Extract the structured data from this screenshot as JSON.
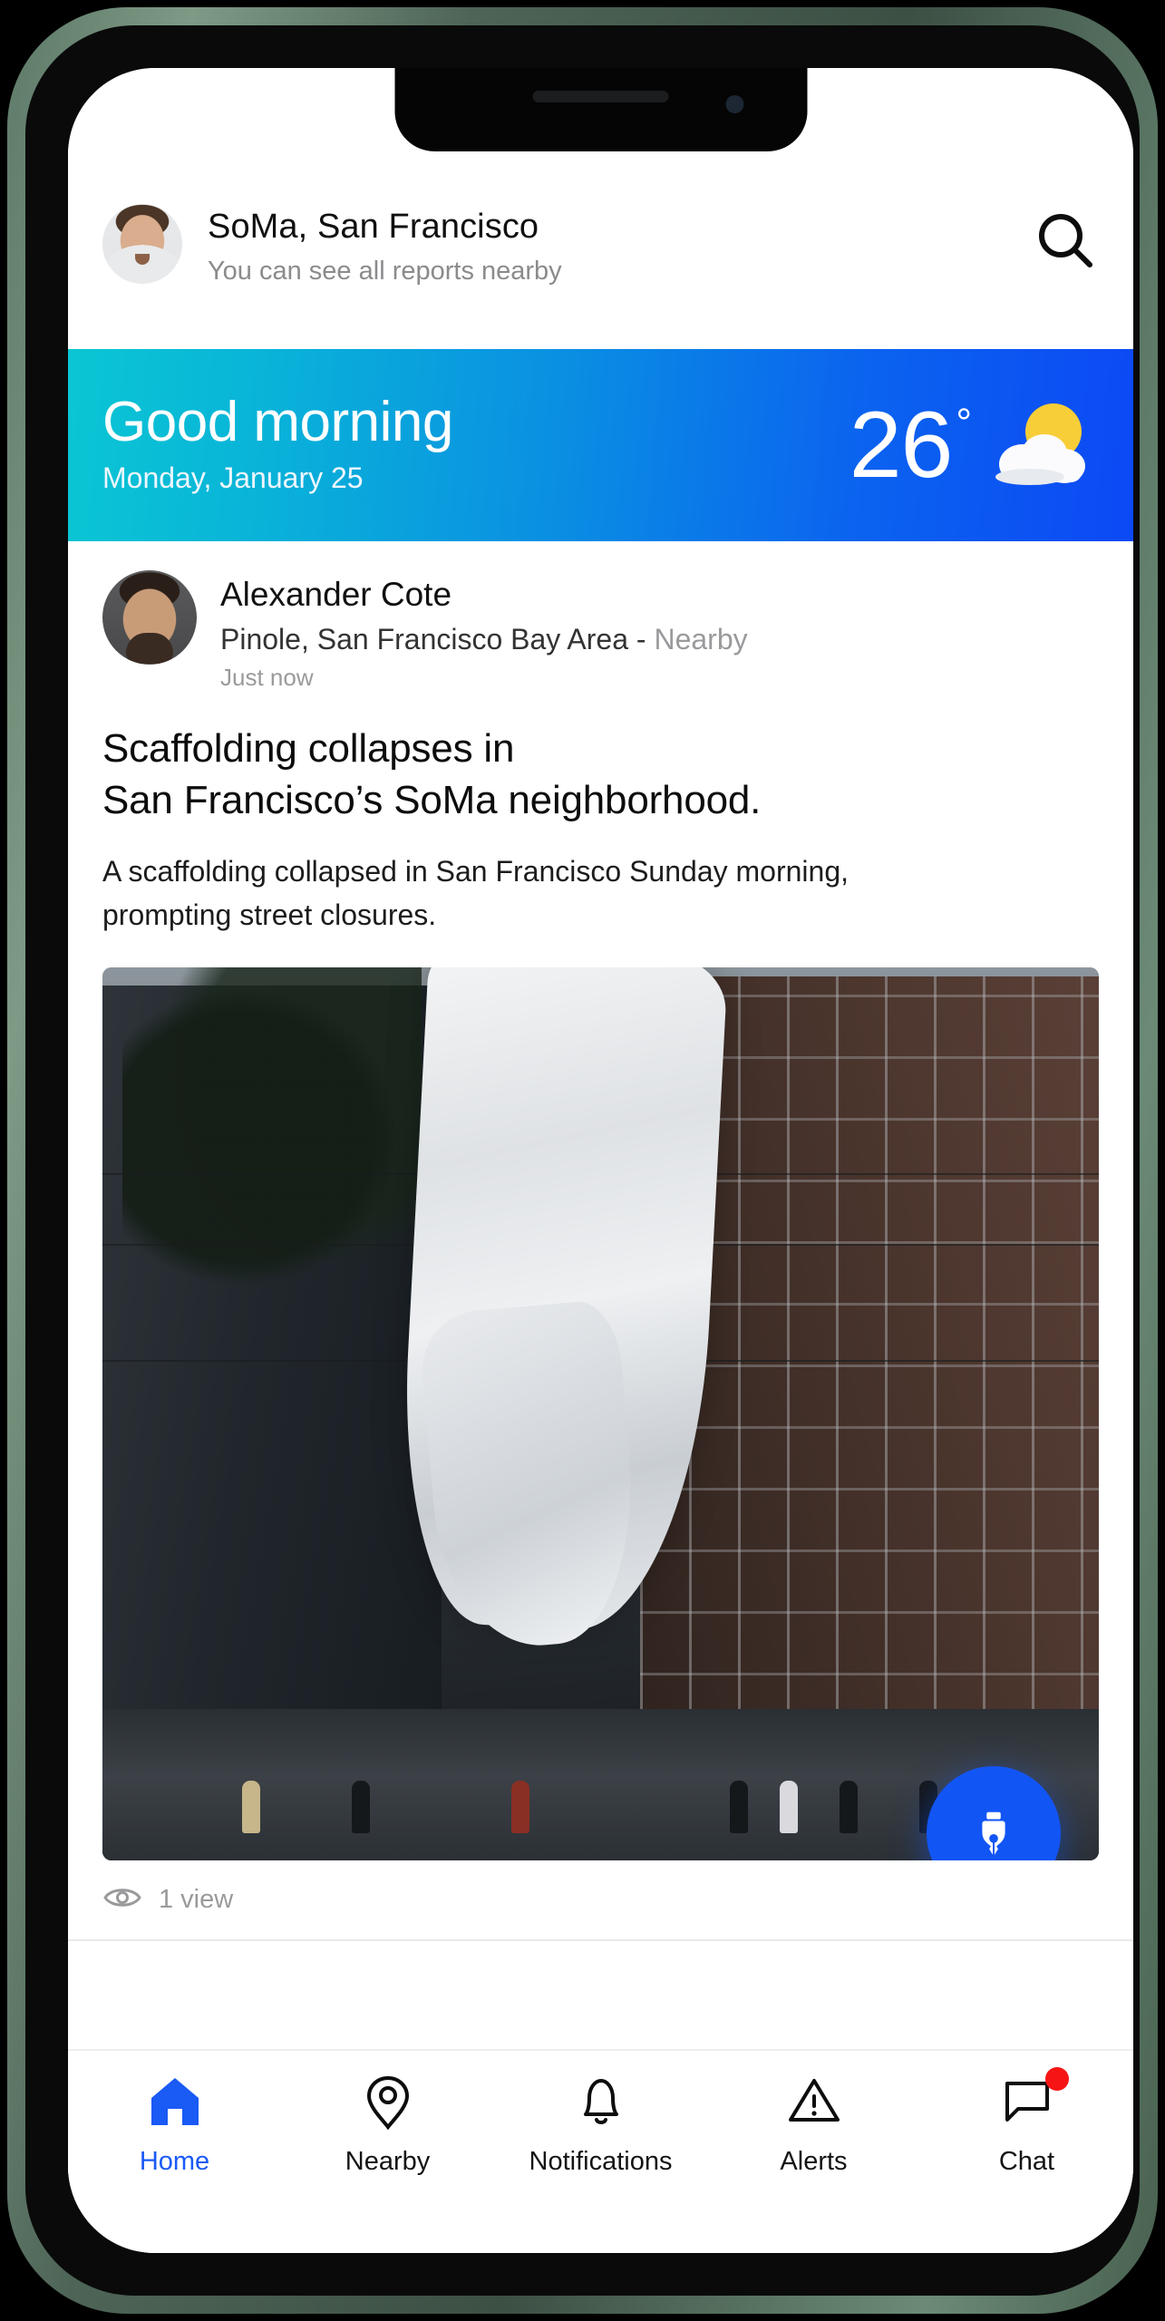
{
  "header": {
    "avatar": "user-avatar",
    "title": "SoMa, San Francisco",
    "subtitle": "You can see all reports nearby",
    "search_icon": "search-icon"
  },
  "weather_banner": {
    "greeting": "Good morning",
    "date": "Monday, January 25",
    "temperature": "26",
    "degree_symbol": "°",
    "icon": "sun-behind-cloud-icon",
    "gradient_start": "#0ac6d4",
    "gradient_end": "#0c49f5"
  },
  "post": {
    "author": "Alexander Cote",
    "location": "Pinole, San Francisco Bay Area - ",
    "proximity": "Nearby",
    "timestamp": "Just now",
    "headline_line1": "Scaffolding collapses in",
    "headline_line2": "San Francisco’s SoMa neighborhood.",
    "body_line1": "A scaffolding collapsed in San Francisco Sunday morning,",
    "body_line2": "prompting street closures.",
    "photo_alt": "collapsed-scaffolding-photo",
    "view_icon": "eye-icon",
    "views": "1 view"
  },
  "fab": {
    "icon": "pen-nib-icon",
    "color": "#1255f5"
  },
  "bottom_nav": {
    "items": [
      {
        "label": "Home",
        "icon": "home-icon",
        "active": true,
        "badge": false
      },
      {
        "label": "Nearby",
        "icon": "map-pin-icon",
        "active": false,
        "badge": false
      },
      {
        "label": "Notifications",
        "icon": "bell-icon",
        "active": false,
        "badge": false
      },
      {
        "label": "Alerts",
        "icon": "warning-triangle-icon",
        "active": false,
        "badge": false
      },
      {
        "label": "Chat",
        "icon": "chat-bubble-icon",
        "active": false,
        "badge": true
      }
    ],
    "active_color": "#1a5af5",
    "badge_color": "#f71414"
  }
}
